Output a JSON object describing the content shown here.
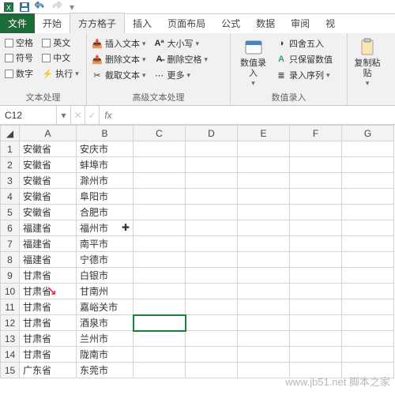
{
  "tabs": {
    "file": "文件",
    "home": "开始",
    "fangfang": "方方格子",
    "insert": "插入",
    "layout": "页面布局",
    "formula": "公式",
    "data": "数据",
    "review": "审阅",
    "vi": "视"
  },
  "ribbon": {
    "g1": {
      "label": "文本处理",
      "c": {
        "blank": "空格",
        "en": "英文",
        "sym": "符号",
        "cn": "中文",
        "num": "数字",
        "exec": "执行"
      }
    },
    "g2": {
      "label": "高级文本处理",
      "left": {
        "ins": "插入文本",
        "del": "删除文本",
        "cut": "截取文本"
      },
      "right": {
        "case": "大小写",
        "delblank": "删除空格",
        "more": "更多"
      }
    },
    "g3": {
      "label": "数值录入",
      "big": "数值录\n入",
      "r": {
        "round": "四舍五入",
        "keep": "只保留数值",
        "seq": "录入序列"
      }
    },
    "g4": {
      "big": "复制粘\n贴"
    }
  },
  "namebox": {
    "ref": "C12",
    "fx": "fx"
  },
  "cols": [
    "A",
    "B",
    "C",
    "D",
    "E",
    "F",
    "G"
  ],
  "rows": [
    {
      "n": 1,
      "a": "安徽省",
      "b": "安庆市"
    },
    {
      "n": 2,
      "a": "安徽省",
      "b": "蚌埠市"
    },
    {
      "n": 3,
      "a": "安徽省",
      "b": "滁州市"
    },
    {
      "n": 4,
      "a": "安徽省",
      "b": "阜阳市"
    },
    {
      "n": 5,
      "a": "安徽省",
      "b": "合肥市"
    },
    {
      "n": 6,
      "a": "福建省",
      "b": "福州市"
    },
    {
      "n": 7,
      "a": "福建省",
      "b": "南平市"
    },
    {
      "n": 8,
      "a": "福建省",
      "b": "宁德市"
    },
    {
      "n": 9,
      "a": "甘肃省",
      "b": "白银市"
    },
    {
      "n": 10,
      "a": "甘肃省",
      "b": "甘南州"
    },
    {
      "n": 11,
      "a": "甘肃省",
      "b": "嘉峪关市"
    },
    {
      "n": 12,
      "a": "甘肃省",
      "b": "酒泉市"
    },
    {
      "n": 13,
      "a": "甘肃省",
      "b": "兰州市"
    },
    {
      "n": 14,
      "a": "甘肃省",
      "b": "陇南市"
    },
    {
      "n": 15,
      "a": "广东省",
      "b": "东莞市"
    }
  ],
  "watermark": "www.jb51.net 脚本之家",
  "selected": {
    "row": 12,
    "col": "C"
  }
}
